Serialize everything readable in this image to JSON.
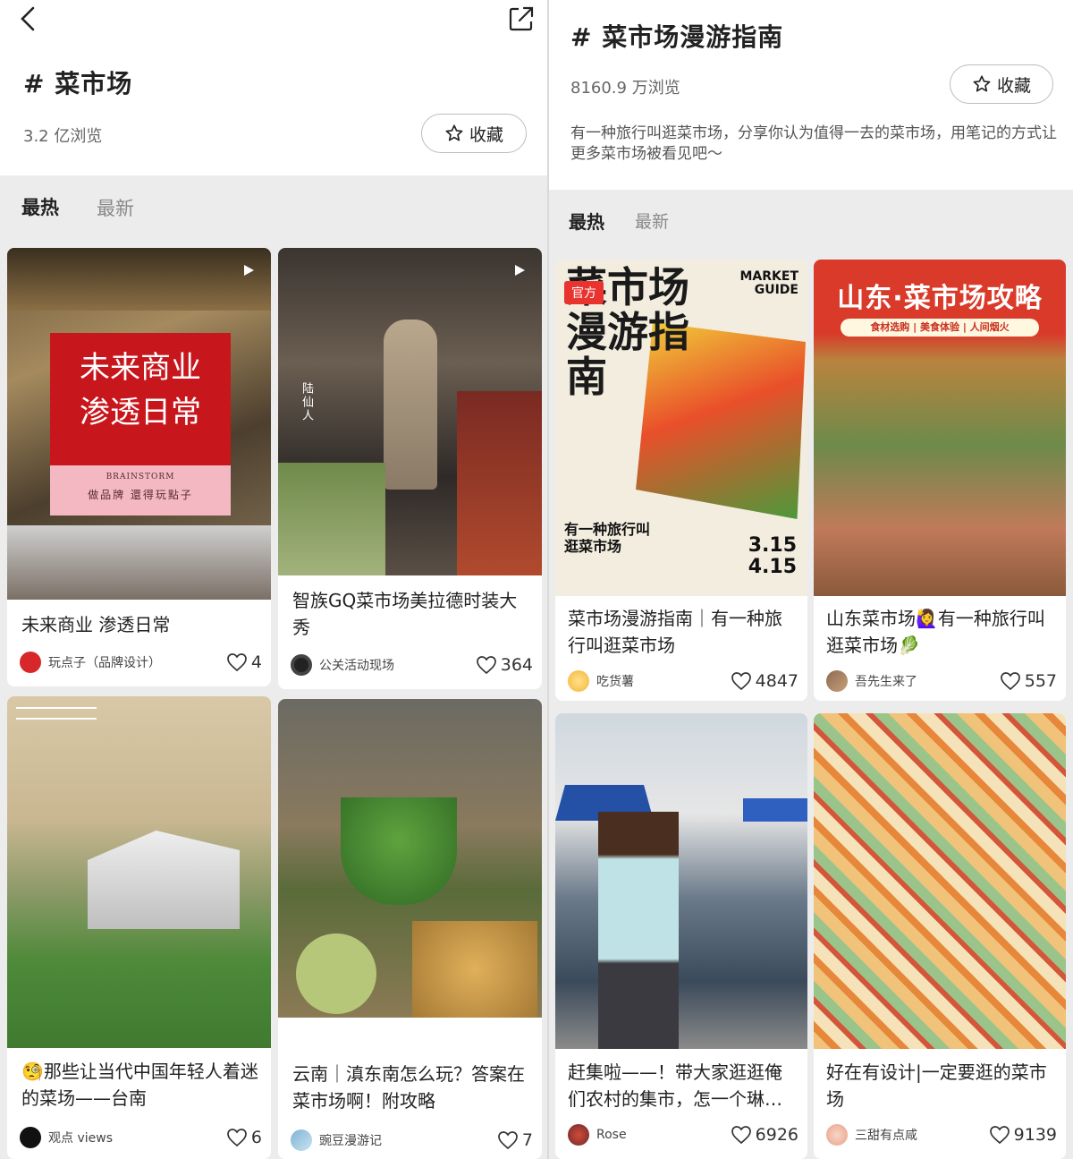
{
  "left": {
    "topic_title": "# 菜市场",
    "views": "3.2 亿浏览",
    "favorite_label": "收藏",
    "tabs": [
      "最热",
      "最新"
    ],
    "cards": [
      {
        "title": "未来商业 渗透日常",
        "author": "玩点子（品牌设计）",
        "likes": "4",
        "overlay_title": "未来商业\n渗透日常",
        "overlay_brand": "BRAINSTORM",
        "overlay_sub": "做品牌 還得玩點子",
        "has_play": true
      },
      {
        "title": "智族GQ菜市场美拉德时装大秀",
        "author": "公关活动现场",
        "likes": "364",
        "overlay_watermark": "陆仙人",
        "has_play": true
      },
      {
        "title": "🧐那些让当代中国年轻人着迷的菜场——台南",
        "author": "观点 views",
        "likes": "6"
      },
      {
        "title": "云南｜滇东南怎么玩？答案在菜市场啊！附攻略",
        "author": "豌豆漫游记",
        "likes": "7"
      }
    ]
  },
  "right": {
    "topic_title": "# 菜市场漫游指南",
    "views": "8160.9 万浏览",
    "favorite_label": "收藏",
    "description": "有一种旅行叫逛菜市场，分享你认为值得一去的菜市场，用笔记的方式让更多菜市场被看见吧～",
    "tabs": [
      "最热",
      "最新"
    ],
    "cards": [
      {
        "title": "菜市场漫游指南｜有一种旅行叫逛菜市场",
        "author": "吃货薯",
        "likes": "4847",
        "badge": "官方",
        "poster_title": "菜市场漫游指南",
        "poster_en": "MARKET\nGUIDE",
        "poster_dates": "3.15\n4.15",
        "poster_sub": "有一种旅行叫逛菜市场"
      },
      {
        "title": "山东菜市场🙋‍♀️有一种旅行叫逛菜市场🥬",
        "author": "吾先生来了",
        "likes": "557",
        "poster_title": "山东·菜市场攻略",
        "poster_tags": "食材选购 | 美食体验 | 人间烟火"
      },
      {
        "title": "赶集啦——！带大家逛逛俺们农村的集市，怎一个琳…",
        "author": "Rose",
        "likes": "6926"
      },
      {
        "title": "好在有设计|一定要逛的菜市场",
        "author": "三甜有点咸",
        "likes": "9139"
      }
    ]
  },
  "colors": {
    "accent": "#e8332e",
    "text": "#222222",
    "muted": "#8a8a8a"
  }
}
